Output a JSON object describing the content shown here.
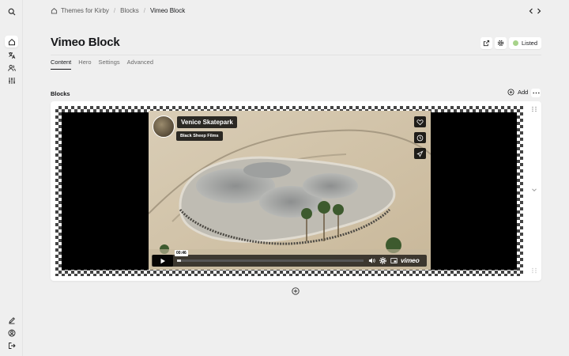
{
  "breadcrumb": {
    "items": [
      "Themes for Kirby",
      "Blocks",
      "Vimeo Block"
    ]
  },
  "page": {
    "title": "Vimeo Block",
    "status_label": "Listed"
  },
  "tabs": [
    {
      "label": "Content",
      "active": true
    },
    {
      "label": "Hero",
      "active": false
    },
    {
      "label": "Settings",
      "active": false
    },
    {
      "label": "Advanced",
      "active": false
    }
  ],
  "blocks": {
    "section_label": "Blocks",
    "add_label": "Add"
  },
  "video": {
    "title": "Venice Skatepark",
    "author": "Black Sheep Films",
    "time": "00:46",
    "progress": 0.02,
    "logo_text": "vimeo"
  },
  "colors": {
    "status_listed": "#a7d38a",
    "accent": "#16171a"
  }
}
